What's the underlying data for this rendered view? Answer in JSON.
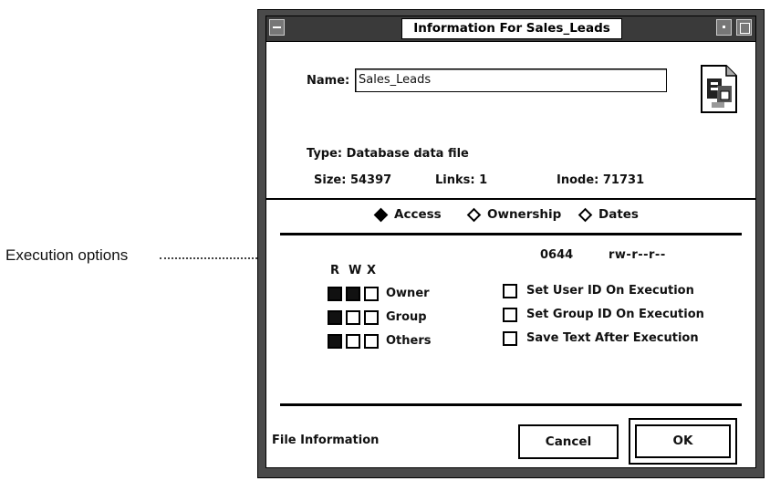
{
  "callout": {
    "label": "Execution options"
  },
  "window": {
    "title": "Information For Sales_Leads",
    "name_label": "Name:",
    "name_value": "Sales_Leads",
    "type_label": "Type:",
    "type_value": "Database data file",
    "size_label": "Size:",
    "size_value": "54397",
    "links_label": "Links:",
    "links_value": "1",
    "inode_label": "Inode:",
    "inode_value": "71731"
  },
  "view_modes": [
    {
      "label": "Access",
      "selected": true
    },
    {
      "label": "Ownership",
      "selected": false
    },
    {
      "label": "Dates",
      "selected": false
    }
  ],
  "permissions": {
    "octal": "0644",
    "symbolic": "rw-r--r--",
    "col_headers": [
      "R",
      "W",
      "X"
    ],
    "rows": [
      {
        "label": "Owner",
        "r": true,
        "w": true,
        "x": false
      },
      {
        "label": "Group",
        "r": true,
        "w": false,
        "x": false
      },
      {
        "label": "Others",
        "r": true,
        "w": false,
        "x": false
      }
    ]
  },
  "exec_options": [
    {
      "label": "Set User ID On Execution",
      "checked": false
    },
    {
      "label": "Set Group ID On Execution",
      "checked": false
    },
    {
      "label": "Save Text After Execution",
      "checked": false
    }
  ],
  "footer": {
    "info_label": "File Information",
    "cancel_label": "Cancel",
    "ok_label": "OK"
  },
  "colors": {
    "frame": "#4a4a4a",
    "client": "#ffffff",
    "text": "#111111"
  },
  "icons": {
    "file": "document-icon",
    "menu": "window-menu-icon",
    "minimize": "minimize-icon",
    "maximize": "maximize-icon"
  }
}
